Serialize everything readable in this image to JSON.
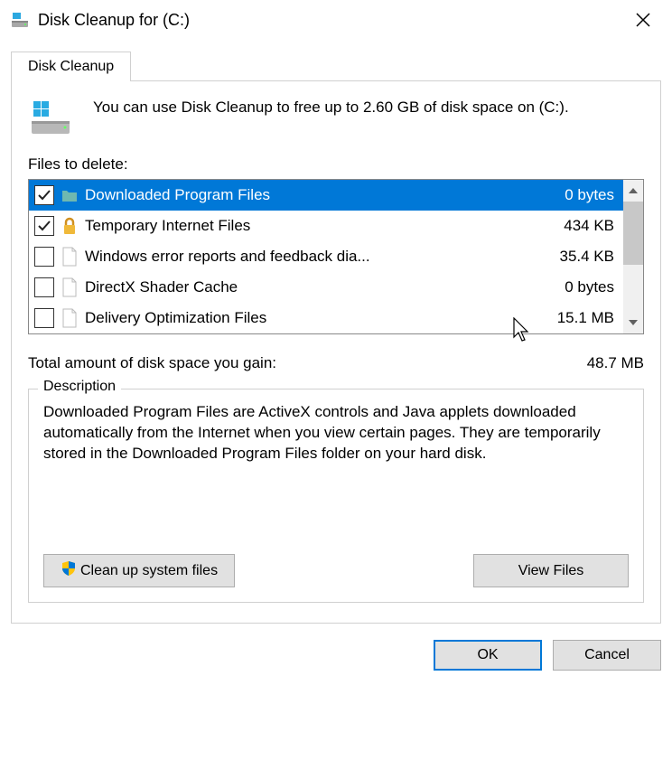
{
  "window": {
    "title": "Disk Cleanup for  (C:)"
  },
  "tabs": {
    "diskCleanup": "Disk Cleanup"
  },
  "intro": {
    "text": "You can use Disk Cleanup to free up to 2.60 GB of disk space on  (C:)."
  },
  "filesToDelete": {
    "label": "Files to delete:",
    "items": [
      {
        "name": "Downloaded Program Files",
        "size": "0 bytes",
        "checked": true,
        "selected": true,
        "icon": "folder"
      },
      {
        "name": "Temporary Internet Files",
        "size": "434 KB",
        "checked": true,
        "selected": false,
        "icon": "lock"
      },
      {
        "name": "Windows error reports and feedback dia...",
        "size": "35.4 KB",
        "checked": false,
        "selected": false,
        "icon": "file"
      },
      {
        "name": "DirectX Shader Cache",
        "size": "0 bytes",
        "checked": false,
        "selected": false,
        "icon": "file"
      },
      {
        "name": "Delivery Optimization Files",
        "size": "15.1 MB",
        "checked": false,
        "selected": false,
        "icon": "file"
      }
    ]
  },
  "total": {
    "label": "Total amount of disk space you gain:",
    "value": "48.7 MB"
  },
  "description": {
    "title": "Description",
    "text": "Downloaded Program Files are ActiveX controls and Java applets downloaded automatically from the Internet when you view certain pages. They are temporarily stored in the Downloaded Program Files folder on your hard disk."
  },
  "buttons": {
    "cleanSystem": "Clean up system files",
    "viewFiles": "View Files",
    "ok": "OK",
    "cancel": "Cancel"
  }
}
